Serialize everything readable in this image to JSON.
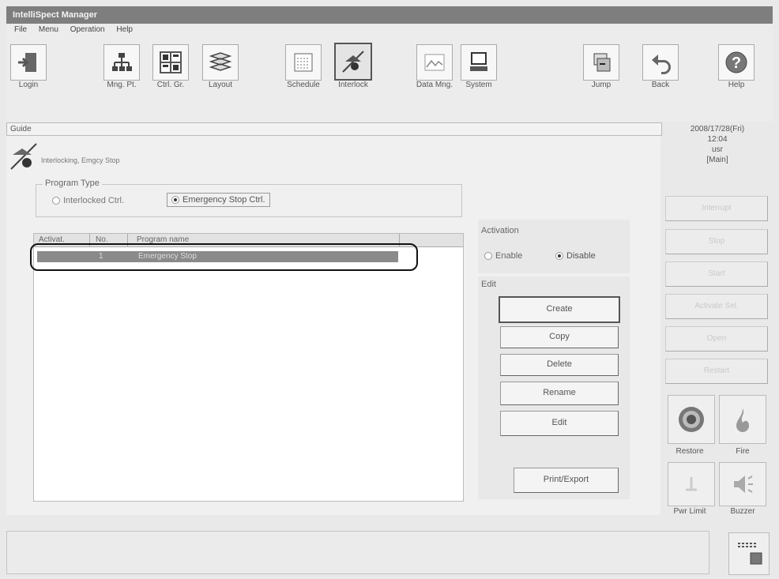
{
  "window": {
    "title": "IntelliSpect Manager"
  },
  "menu": [
    "File",
    "Menu",
    "Operation",
    "Help"
  ],
  "toolbar": [
    {
      "label": "Login",
      "icon": "login-door-icon"
    },
    {
      "label": "Mng. Pt.",
      "icon": "management-point-icon"
    },
    {
      "label": "Ctrl. Gr.",
      "icon": "control-group-icon"
    },
    {
      "label": "Layout",
      "icon": "layout-icon"
    },
    {
      "label": "Schedule",
      "icon": "schedule-icon"
    },
    {
      "label": "Interlock",
      "icon": "interlock-icon"
    },
    {
      "label": "Data Mng.",
      "icon": "data-management-icon"
    },
    {
      "label": "System",
      "icon": "system-computer-icon"
    },
    {
      "label": "Jump",
      "icon": "jump-icon"
    },
    {
      "label": "Back",
      "icon": "back-arrow-icon"
    },
    {
      "label": "Help",
      "icon": "help-question-icon"
    }
  ],
  "guide": {
    "label": "Guide"
  },
  "breadcrumb": {
    "text": "Interlocking, Emgcy Stop"
  },
  "datetime": {
    "date": "2008/17/28(Fri)",
    "time": "12:04",
    "user": "usr",
    "mode": "[Main]"
  },
  "program_type": {
    "title": "Program Type",
    "options": [
      {
        "label": "Interlocked Ctrl.",
        "selected": false
      },
      {
        "label": "Emergency Stop Ctrl.",
        "selected": true
      }
    ]
  },
  "program_list": {
    "columns": [
      "Activat.",
      "No.",
      "Program name"
    ],
    "rows": [
      {
        "activat": "",
        "no": "1",
        "name": "Emergency Stop"
      }
    ]
  },
  "activation": {
    "title": "Activation",
    "options": [
      {
        "label": "Enable",
        "selected": false
      },
      {
        "label": "Disable",
        "selected": true
      }
    ]
  },
  "edit": {
    "title": "Edit",
    "buttons": [
      "Create",
      "Copy",
      "Delete",
      "Rename",
      "Edit",
      "Print/Export"
    ]
  },
  "side_buttons": [
    {
      "label": "Interrupt",
      "enabled": false
    },
    {
      "label": "Stop",
      "enabled": false
    },
    {
      "label": "Start",
      "enabled": false
    },
    {
      "label": "Activate Sel.",
      "enabled": false
    },
    {
      "label": "Open",
      "enabled": false
    },
    {
      "label": "Restart",
      "enabled": false
    }
  ],
  "bottom_tools": [
    {
      "label": "Restore",
      "icon": "restore-icon"
    },
    {
      "label": "Fire",
      "icon": "fire-icon"
    },
    {
      "label": "Pwr Limit",
      "icon": "power-limit-icon"
    },
    {
      "label": "Buzzer",
      "icon": "buzzer-icon"
    }
  ]
}
